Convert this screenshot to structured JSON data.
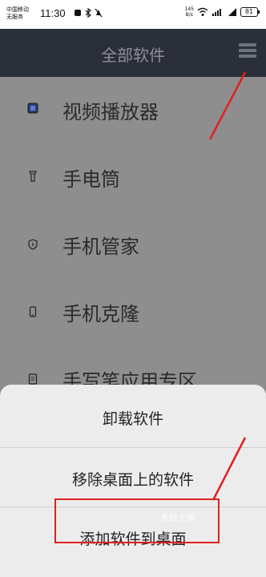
{
  "status_bar": {
    "carrier_line1": "中国移动",
    "carrier_line2": "无服务",
    "time": "11:30",
    "net_speed_value": "145",
    "net_speed_unit": "B/s",
    "battery": "81"
  },
  "header": {
    "title": "全部软件"
  },
  "apps": [
    {
      "label": "视频播放器",
      "icon": "video-player-icon"
    },
    {
      "label": "手电筒",
      "icon": "flashlight-icon"
    },
    {
      "label": "手机管家",
      "icon": "shield-icon"
    },
    {
      "label": "手机克隆",
      "icon": "phone-clone-icon"
    },
    {
      "label": "手写笔应用专区",
      "icon": "notebook-icon"
    }
  ],
  "sheet": {
    "item1": "卸载软件",
    "item2": "移除桌面上的软件",
    "item3": "添加软件到桌面"
  },
  "watermark": "系统之家",
  "colors": {
    "header_bg": "#2a2f3a",
    "overlay": "#8e8e8e",
    "sheet_bg": "#ececec",
    "annotation_red": "#e02020"
  }
}
